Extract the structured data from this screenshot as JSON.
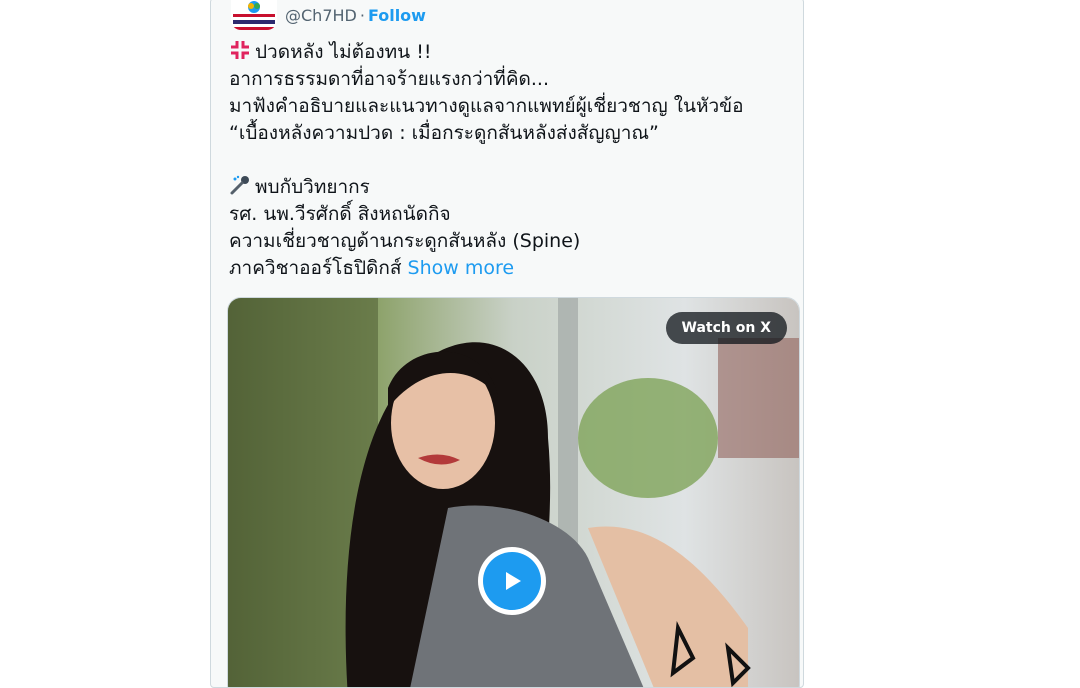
{
  "tweet": {
    "handle": "@Ch7HD",
    "separator": "·",
    "follow_label": "Follow",
    "more_label": "···",
    "lines": [
      {
        "icon": "anger-symbol-icon",
        "text": "ปวดหลัง ไม่ต้องทน !!"
      },
      {
        "text": "อาการธรรมดาที่อาจร้ายแรงกว่าที่คิด..."
      },
      {
        "text": "มาฟังคำอธิบายและแนวทางดูแลจากแพทย์ผู้เชี่ยวชาญ ในหัวข้อ"
      },
      {
        "text": "“เบื้องหลังความปวด : เมื่อกระดูกสันหลังส่งสัญญาณ”"
      },
      {
        "text": ""
      },
      {
        "icon": "microphone-icon",
        "text": "พบกับวิทยากร"
      },
      {
        "text": "รศ. นพ.วีรศักดิ์ สิงหถนัดกิจ"
      },
      {
        "text": "ความเชี่ยวชาญด้านกระดูกสันหลัง (Spine)"
      },
      {
        "text": "ภาควิชาออร์โธปิดิกส์"
      }
    ],
    "show_more_label": "Show more",
    "media": {
      "watch_label": "Watch on X",
      "play_icon": "play-icon"
    }
  },
  "colors": {
    "accent": "#1d9bf0",
    "text": "#0f1419",
    "secondary": "#536471"
  }
}
